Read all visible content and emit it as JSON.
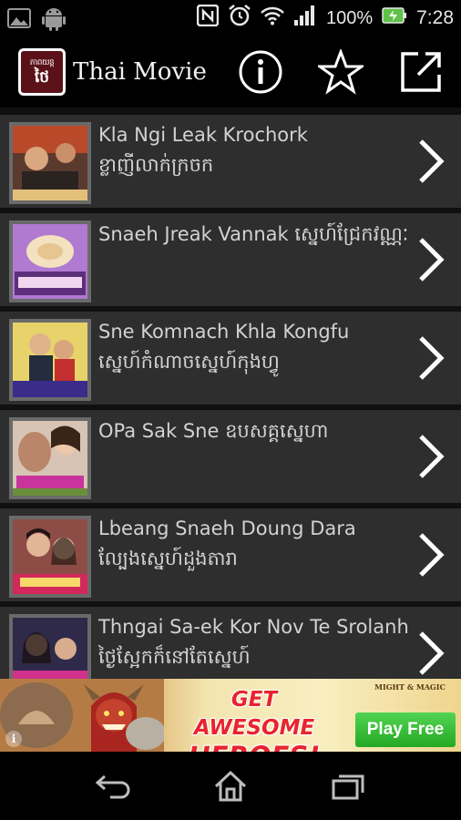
{
  "status_bar": {
    "battery": "100%",
    "time": "7:28",
    "icons": [
      "image-icon",
      "android-icon",
      "nfc-icon",
      "alarm-icon",
      "wifi-icon",
      "signal-icon",
      "battery-charging-icon"
    ]
  },
  "action_bar": {
    "title": "Thai Movie",
    "logo_text_top": "ភាពយន្ត",
    "logo_text_bottom": "ថៃ",
    "actions": [
      "info-icon",
      "star-icon",
      "share-icon"
    ]
  },
  "list": {
    "items": [
      {
        "title": "Kla Ngi Leak Krochork",
        "subtitle": "ខ្លាញីលាក់ក្រចក"
      },
      {
        "title": "Snaeh Jreak Vannak ស្នេហ៍ជ្រែកវណ្ណៈ",
        "subtitle": ""
      },
      {
        "title": "Sne Komnach Khla Kongfu",
        "subtitle": "ស្នេហ៍កំណាចស្នេហ៍កុងហ្វូ"
      },
      {
        "title": "OPa Sak Sne ឧបសគ្គស្នេហា",
        "subtitle": ""
      },
      {
        "title": "Lbeang Snaeh Doung Dara",
        "subtitle": "ល្បែងស្នេហ៍ដួងតារា"
      },
      {
        "title": "Thngai Sa-ek Kor Nov Te Srolanh",
        "subtitle": "ថ្ងៃស្អែកក៏នៅតែស្នេហ៍"
      }
    ]
  },
  "ad": {
    "headline_line1": "GET AWESOME",
    "headline_line2": "HEROES!",
    "brand": "MIGHT & MAGIC",
    "cta": "Play Free",
    "info": "i"
  },
  "nav_bar": {
    "buttons": [
      "back-icon",
      "home-icon",
      "recents-icon"
    ]
  },
  "colors": {
    "row_background": "#2e2e2e",
    "row_text": "#d2d2d2",
    "play_button": "#2fb52f",
    "ad_headline": "#e8242f"
  }
}
